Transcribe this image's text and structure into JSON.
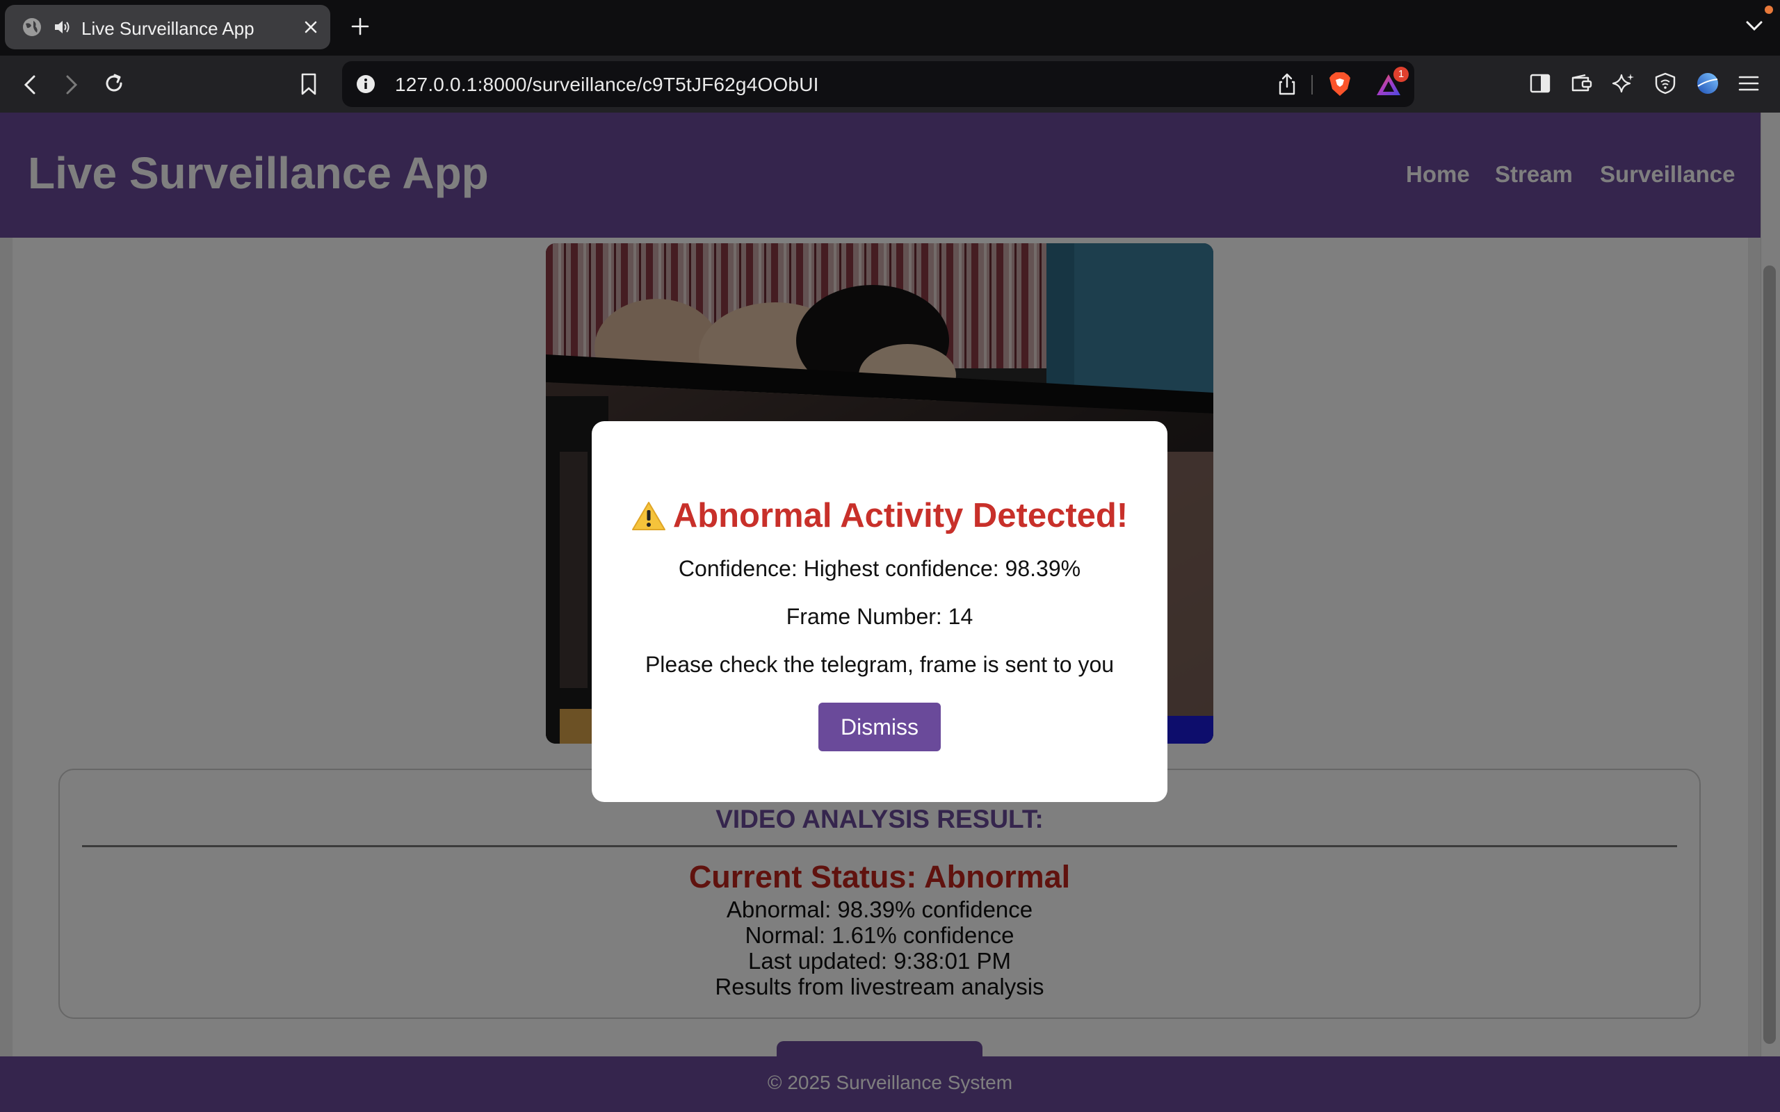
{
  "browser": {
    "tab_title": "Live Surveillance App",
    "url": "127.0.0.1:8000/surveillance/c9T5tJF62g4OObUI",
    "rewards_badge": "1",
    "icons": [
      "globe-icon",
      "speaker-icon",
      "close-icon",
      "plus-icon",
      "chevron-down-icon",
      "back-icon",
      "forward-icon",
      "reload-icon",
      "bookmark-icon",
      "info-icon",
      "share-icon",
      "brave-icon",
      "rewards-icon",
      "sidebar-icon",
      "wallet-icon",
      "leo-icon",
      "vpn-icon",
      "profile-icon",
      "menu-icon"
    ]
  },
  "navbar": {
    "brand": "Live Surveillance App",
    "links": [
      "Home",
      "Stream",
      "Surveillance"
    ]
  },
  "result": {
    "heading": "VIDEO ANALYSIS RESULT:",
    "status": "Current Status: Abnormal",
    "abnormal": "Abnormal: 98.39% confidence",
    "normal": "Normal: 1.61% confidence",
    "updated": "Last updated: 9:38:01 PM",
    "source": "Results from livestream analysis"
  },
  "footer": {
    "text": "© 2025 Surveillance System"
  },
  "modal": {
    "title": "Abnormal Activity Detected!",
    "confidence": "Confidence: Highest confidence: 98.39%",
    "frame": "Frame Number: 14",
    "message": "Please check the telegram, frame is sent to you",
    "button": "Dismiss"
  },
  "colors": {
    "brand_purple": "#6a4a9a",
    "alert_red": "#c8302a",
    "status_red": "#c1241c"
  }
}
